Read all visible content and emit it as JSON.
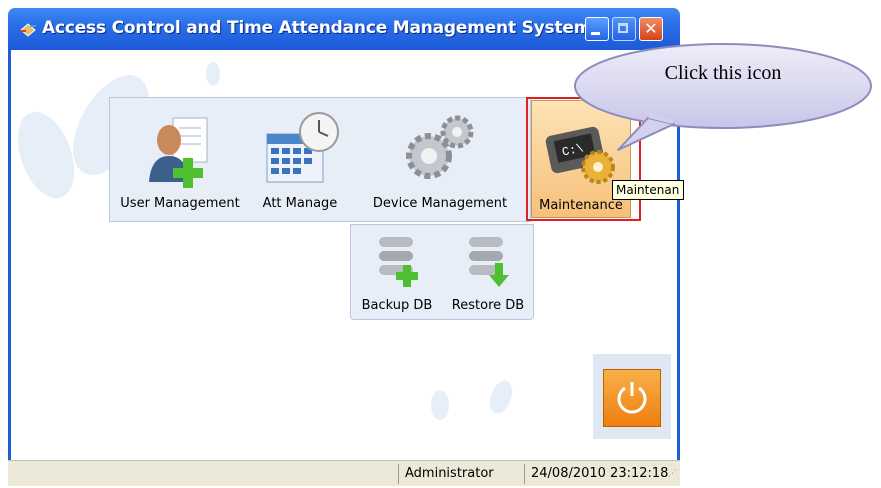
{
  "window": {
    "title": "Access Control and Time Attendance Management System"
  },
  "toolbar": {
    "items": [
      {
        "label": "User Management",
        "icon": "user-add-icon"
      },
      {
        "label": "Att Manage",
        "icon": "calendar-clock-icon"
      },
      {
        "label": "Device Management",
        "icon": "gears-icon"
      }
    ],
    "maintenance": {
      "label": "Maintenance",
      "icon": "maintenance-icon",
      "selected": true
    }
  },
  "submenu": {
    "items": [
      {
        "label": "Backup DB",
        "icon": "database-add-icon"
      },
      {
        "label": "Restore DB",
        "icon": "database-restore-icon"
      }
    ]
  },
  "tooltip": {
    "text": "Maintenan"
  },
  "callout": {
    "text": "Click this icon"
  },
  "status": {
    "user": "Administrator",
    "datetime": "24/08/2010 23:12:18"
  },
  "colors": {
    "titlebar": "#2a6ee8",
    "highlight_border": "#e02020",
    "power_button": "#f39a1f",
    "panel": "#e8eef8"
  }
}
